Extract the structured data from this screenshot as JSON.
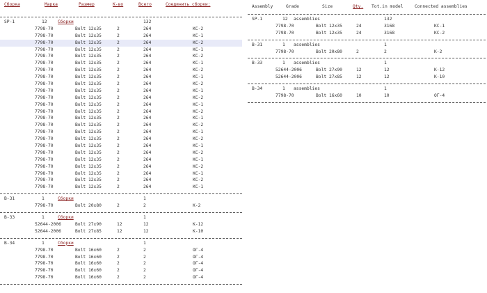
{
  "left": {
    "headers": [
      "Сборка",
      "Марка",
      "Размер",
      "К-во",
      "Всего",
      "Соединить сборки:"
    ],
    "assemblies_label": "Сборки",
    "groups": [
      {
        "assembly": "SP-1",
        "count": "12",
        "total": "132",
        "rows": [
          {
            "grade": "7798-70",
            "size": "Bolt 12x35",
            "qty": "2",
            "total": "264",
            "conn": "КС-2"
          },
          {
            "grade": "7798-70",
            "size": "Bolt 12x35",
            "qty": "2",
            "total": "264",
            "conn": "КС-1"
          },
          {
            "grade": "7798-70",
            "size": "Bolt 12x35",
            "qty": "2",
            "total": "264",
            "conn": "КС-2",
            "selected": true
          },
          {
            "grade": "7798-70",
            "size": "Bolt 12x35",
            "qty": "2",
            "total": "264",
            "conn": "КС-1"
          },
          {
            "grade": "7798-70",
            "size": "Bolt 12x35",
            "qty": "2",
            "total": "264",
            "conn": "КС-2"
          },
          {
            "grade": "7798-70",
            "size": "Bolt 12x35",
            "qty": "2",
            "total": "264",
            "conn": "КС-1"
          },
          {
            "grade": "7798-70",
            "size": "Bolt 12x35",
            "qty": "2",
            "total": "264",
            "conn": "КС-2"
          },
          {
            "grade": "7798-70",
            "size": "Bolt 12x35",
            "qty": "2",
            "total": "264",
            "conn": "КС-1"
          },
          {
            "grade": "7798-70",
            "size": "Bolt 12x35",
            "qty": "2",
            "total": "264",
            "conn": "КС-2"
          },
          {
            "grade": "7798-70",
            "size": "Bolt 12x35",
            "qty": "2",
            "total": "264",
            "conn": "КС-1"
          },
          {
            "grade": "7798-70",
            "size": "Bolt 12x35",
            "qty": "2",
            "total": "264",
            "conn": "КС-2"
          },
          {
            "grade": "7798-70",
            "size": "Bolt 12x35",
            "qty": "2",
            "total": "264",
            "conn": "КС-1"
          },
          {
            "grade": "7798-70",
            "size": "Bolt 12x35",
            "qty": "2",
            "total": "264",
            "conn": "КС-2"
          },
          {
            "grade": "7798-70",
            "size": "Bolt 12x35",
            "qty": "2",
            "total": "264",
            "conn": "КС-1"
          },
          {
            "grade": "7798-70",
            "size": "Bolt 12x35",
            "qty": "2",
            "total": "264",
            "conn": "КС-2"
          },
          {
            "grade": "7798-70",
            "size": "Bolt 12x35",
            "qty": "2",
            "total": "264",
            "conn": "КС-1"
          },
          {
            "grade": "7798-70",
            "size": "Bolt 12x35",
            "qty": "2",
            "total": "264",
            "conn": "КС-2"
          },
          {
            "grade": "7798-70",
            "size": "Bolt 12x35",
            "qty": "2",
            "total": "264",
            "conn": "КС-1"
          },
          {
            "grade": "7798-70",
            "size": "Bolt 12x35",
            "qty": "2",
            "total": "264",
            "conn": "КС-2"
          },
          {
            "grade": "7798-70",
            "size": "Bolt 12x35",
            "qty": "2",
            "total": "264",
            "conn": "КС-1"
          },
          {
            "grade": "7798-70",
            "size": "Bolt 12x35",
            "qty": "2",
            "total": "264",
            "conn": "КС-2"
          },
          {
            "grade": "7798-70",
            "size": "Bolt 12x35",
            "qty": "2",
            "total": "264",
            "conn": "КС-1"
          },
          {
            "grade": "7798-70",
            "size": "Bolt 12x35",
            "qty": "2",
            "total": "264",
            "conn": "КС-2"
          },
          {
            "grade": "7798-70",
            "size": "Bolt 12x35",
            "qty": "2",
            "total": "264",
            "conn": "КС-1"
          }
        ]
      },
      {
        "assembly": "B-31",
        "count": "1",
        "total": "1",
        "rows": [
          {
            "grade": "7798-70",
            "size": "Bolt 20x80",
            "qty": "2",
            "total": "2",
            "conn": "К-2"
          }
        ]
      },
      {
        "assembly": "B-33",
        "count": "1",
        "total": "1",
        "rows": [
          {
            "grade": "52644-2006",
            "size": "Bolt 27x90",
            "qty": "12",
            "total": "12",
            "conn": "К-12"
          },
          {
            "grade": "52644-2006",
            "size": "Bolt 27x85",
            "qty": "12",
            "total": "12",
            "conn": "К-10"
          }
        ]
      },
      {
        "assembly": "B-34",
        "count": "1",
        "total": "1",
        "rows": [
          {
            "grade": "7798-70",
            "size": "Bolt 16x60",
            "qty": "2",
            "total": "2",
            "conn": "ОГ-4"
          },
          {
            "grade": "7798-70",
            "size": "Bolt 16x60",
            "qty": "2",
            "total": "2",
            "conn": "ОГ-4"
          },
          {
            "grade": "7798-70",
            "size": "Bolt 16x60",
            "qty": "2",
            "total": "2",
            "conn": "ОГ-4"
          },
          {
            "grade": "7798-70",
            "size": "Bolt 16x60",
            "qty": "2",
            "total": "2",
            "conn": "ОГ-4"
          },
          {
            "grade": "7798-70",
            "size": "Bolt 16x60",
            "qty": "2",
            "total": "2",
            "conn": "ОГ-4"
          }
        ]
      }
    ]
  },
  "right": {
    "headers": [
      "Assembly",
      "Grade",
      "Size",
      "Qty.",
      "Tot.in model",
      "Connected assemblies"
    ],
    "assemblies_label": "assemblies",
    "groups": [
      {
        "assembly": "SP-1",
        "count": "12",
        "total": "132",
        "rows": [
          {
            "grade": "7798-70",
            "size": "Bolt 12x35",
            "qty": "24",
            "total": "3168",
            "conn": "КС-1"
          },
          {
            "grade": "7798-70",
            "size": "Bolt 12x35",
            "qty": "24",
            "total": "3168",
            "conn": "КС-2"
          }
        ]
      },
      {
        "assembly": "B-31",
        "count": "1",
        "total": "1",
        "rows": [
          {
            "grade": "7798-70",
            "size": "Bolt 20x80",
            "qty": "2",
            "total": "2",
            "conn": "К-2"
          }
        ]
      },
      {
        "assembly": "B-33",
        "count": "1",
        "total": "1",
        "rows": [
          {
            "grade": "52644-2006",
            "size": "Bolt 27x90",
            "qty": "12",
            "total": "12",
            "conn": "К-12"
          },
          {
            "grade": "52644-2006",
            "size": "Bolt 27x85",
            "qty": "12",
            "total": "12",
            "conn": "К-10"
          }
        ]
      },
      {
        "assembly": "B-34",
        "count": "1",
        "total": "1",
        "rows": [
          {
            "grade": "7798-70",
            "size": "Bolt 16x60",
            "qty": "10",
            "total": "10",
            "conn": "ОГ-4"
          }
        ]
      }
    ]
  }
}
